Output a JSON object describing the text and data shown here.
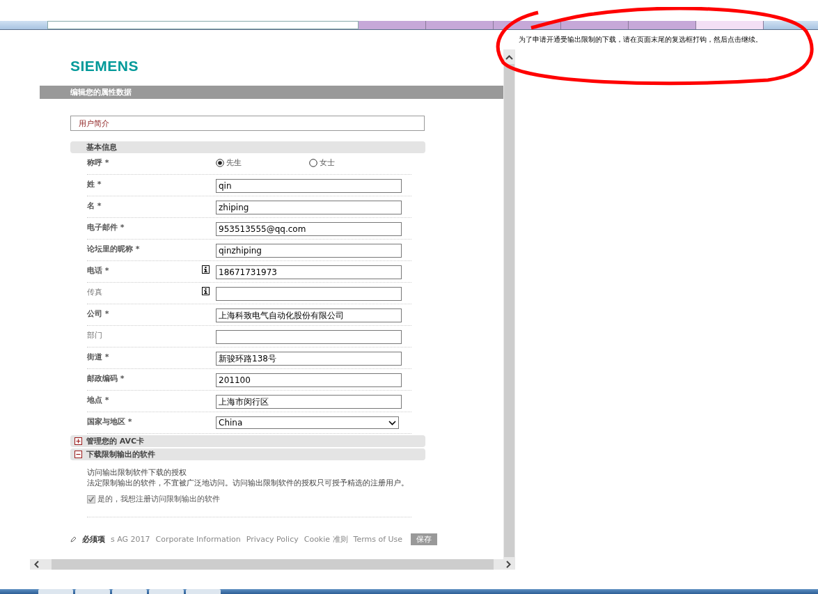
{
  "page_header": {
    "logo": "SIEMENS",
    "title": "编辑您的属性数据"
  },
  "profile_tab": {
    "label": "用户简介"
  },
  "basic_info": {
    "title": "基本信息",
    "salutation": {
      "label": "称呼 *",
      "options": [
        {
          "label": "先生",
          "selected": true
        },
        {
          "label": "女士",
          "selected": false
        }
      ]
    },
    "fields": [
      {
        "label": "姓 *",
        "required": true,
        "info": false,
        "kind": "text",
        "value": "qin"
      },
      {
        "label": "名 *",
        "required": true,
        "info": false,
        "kind": "text",
        "value": "zhiping"
      },
      {
        "label": "电子邮件 *",
        "required": true,
        "info": false,
        "kind": "text",
        "value": "953513555@qq.com"
      },
      {
        "label": "论坛里的昵称 *",
        "required": true,
        "info": false,
        "kind": "text",
        "value": "qinzhiping"
      },
      {
        "label": "电话 *",
        "required": true,
        "info": true,
        "kind": "text",
        "value": "18671731973"
      },
      {
        "label": "传真",
        "required": false,
        "info": true,
        "kind": "text"
      },
      {
        "label": "公司 *",
        "required": true,
        "info": false,
        "kind": "text",
        "value": "上海科致电气自动化股份有限公司"
      },
      {
        "label": "部门",
        "required": false,
        "info": false,
        "kind": "text"
      },
      {
        "label": "街道 *",
        "required": true,
        "info": false,
        "kind": "text",
        "value": "新骏环路138号"
      },
      {
        "label": "邮政编码 *",
        "required": true,
        "info": false,
        "kind": "text",
        "value": "201100"
      },
      {
        "label": "地点 *",
        "required": true,
        "info": false,
        "kind": "text",
        "value": "上海市闵行区"
      },
      {
        "label": "国家与地区 *",
        "required": true,
        "info": false,
        "kind": "select",
        "value": "China"
      }
    ]
  },
  "panels": [
    {
      "title": "管理您的 AVC卡",
      "expanded": false
    },
    {
      "title": "下载限制输出的软件",
      "expanded": true,
      "heading": "访问输出限制软件下载的授权",
      "description": "法定限制输出的软件，不宜被广泛地访问。访问输出限制软件的授权只可授予精选的注册用户。",
      "checkbox": {
        "label": "是的，我想注册访问限制输出的软件",
        "checked": true,
        "disabled": true
      }
    }
  ],
  "footer": {
    "required_note": "必须项",
    "links": [
      "s AG 2017",
      "Corporate Information",
      "Privacy Policy",
      "Cookie 准则",
      "Terms of Use"
    ],
    "save_button": "保存"
  },
  "notice": "为了申请开通受输出限制的下载，请在页面末尾的复选框打钩，然后点击继续。"
}
